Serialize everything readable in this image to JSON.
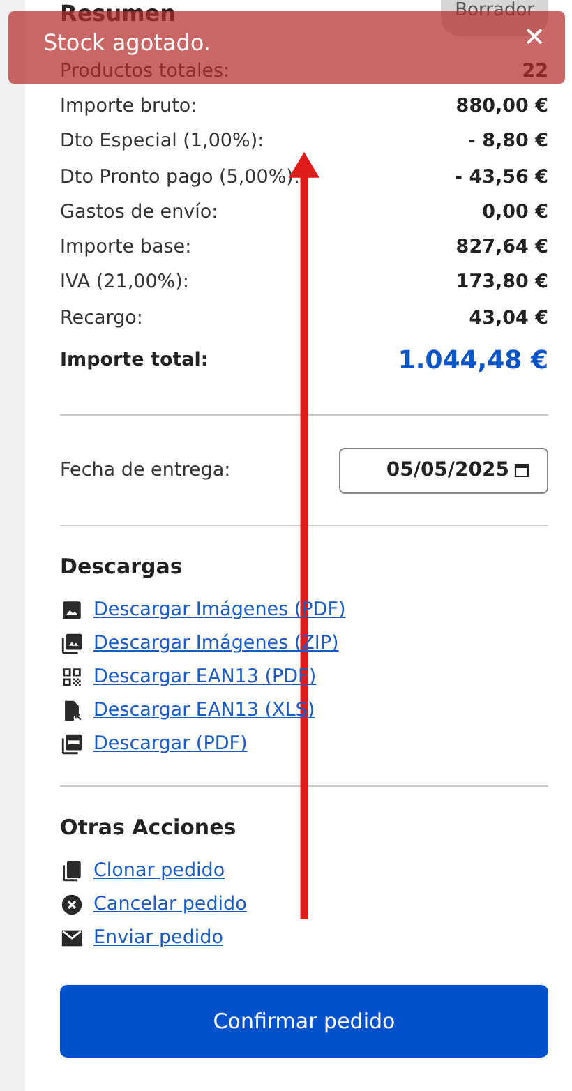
{
  "summary": {
    "title": "Resumen",
    "badge": "Borrador",
    "rows": [
      {
        "label": "Productos totales:",
        "value": "22"
      },
      {
        "label": "Importe bruto:",
        "value": "880,00 €"
      },
      {
        "label": "Dto Especial (1,00%):",
        "value": "- 8,80 €"
      },
      {
        "label": "Dto Pronto pago (5,00%):",
        "value": "- 43,56 €"
      },
      {
        "label": "Gastos de envío:",
        "value": "0,00 €"
      },
      {
        "label": "Importe base:",
        "value": "827,64 €"
      },
      {
        "label": "IVA (21,00%):",
        "value": "173,80 €"
      },
      {
        "label": "Recargo:",
        "value": "43,04 €"
      }
    ],
    "total": {
      "label": "Importe total:",
      "value": "1.044,48 €"
    }
  },
  "delivery": {
    "label": "Fecha de entrega:",
    "value": "05/05/2025"
  },
  "downloads": {
    "title": "Descargas",
    "links": [
      {
        "kind": "image",
        "label": "Descargar Imágenes (PDF)"
      },
      {
        "kind": "images",
        "label": "Descargar Imágenes (ZIP)"
      },
      {
        "kind": "qr",
        "label": "Descargar EAN13 (PDF)"
      },
      {
        "kind": "file",
        "label": "Descargar EAN13 (XLS)"
      },
      {
        "kind": "pdf",
        "label": "Descargar (PDF)"
      }
    ]
  },
  "actions": {
    "title": "Otras Acciones",
    "links": [
      {
        "kind": "copy",
        "label": "Clonar pedido"
      },
      {
        "kind": "cancel",
        "label": "Cancelar pedido"
      },
      {
        "kind": "mail",
        "label": "Enviar pedido"
      }
    ]
  },
  "confirm_button": "Confirmar pedido",
  "toast": {
    "message": "Stock agotado.",
    "close": "✕"
  }
}
